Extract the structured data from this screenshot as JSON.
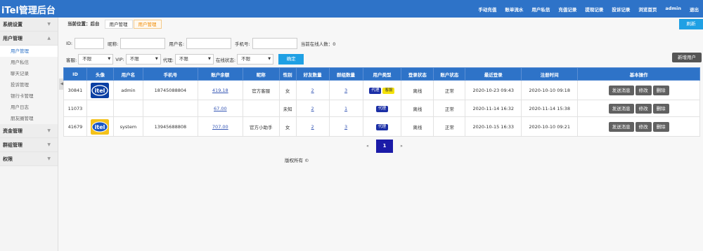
{
  "topbar": {
    "brand": "iTel管理后台",
    "nav": [
      "手动充值",
      "账单流水",
      "用户私信",
      "充值记录",
      "提现记录",
      "投诉记录",
      "浏览首页",
      "admin",
      "退出"
    ]
  },
  "sidebar": {
    "sections": [
      {
        "label": "系统设置",
        "items": []
      },
      {
        "label": "用户管理",
        "items": [
          "用户管理",
          "用户私信",
          "聊天记录",
          "投诉管理",
          "银行卡管理",
          "用户日志",
          "朋友圈管理"
        ]
      },
      {
        "label": "资金管理",
        "items": []
      },
      {
        "label": "群组管理",
        "items": []
      },
      {
        "label": "权限",
        "items": []
      }
    ]
  },
  "breadcrumb": {
    "prefix": "当前位置：后台",
    "level1": "用户管理",
    "current": "用户管理"
  },
  "refresh_label": "刷新",
  "filters": {
    "id_label": "ID:",
    "nickname_label": "昵称:",
    "username_label": "用户名:",
    "phone_label": "手机号:",
    "online_text": "当前在线人数：0",
    "cs_label": "客服:",
    "cs_value": "不限",
    "vip_label": "VIP:",
    "vip_value": "不限",
    "agent_label": "代理:",
    "agent_value": "不限",
    "online_label": "在线状态:",
    "online_value": "不限",
    "confirm": "确定",
    "new_user": "新增用户"
  },
  "table": {
    "headers": [
      "ID",
      "头像",
      "用户名",
      "手机号",
      "账户余额",
      "昵称",
      "性别",
      "好友数量",
      "群组数量",
      "用户类型",
      "登录状态",
      "账户状态",
      "最近登录",
      "注册时间",
      "基本操作"
    ],
    "rows": [
      {
        "id": "30841",
        "username": "admin",
        "phone": "18745088804",
        "balance": "419.18",
        "nickname": "官方客服",
        "gender": "女",
        "friends": "2",
        "groups": "3",
        "tags": [
          "代理",
          "客服"
        ],
        "login": "离线",
        "status": "正常",
        "last_login": "2020-10-23 09:43",
        "registered": "2020-10-10 09:18"
      },
      {
        "id": "11073",
        "username": "",
        "phone": "",
        "balance": "67.00",
        "nickname": "",
        "gender": "未知",
        "friends": "2",
        "groups": "1",
        "tags": [
          "代理"
        ],
        "login": "离线",
        "status": "正常",
        "last_login": "2020-11-14 16:32",
        "registered": "2020-11-14 15:38"
      },
      {
        "id": "41679",
        "username": "system",
        "phone": "13945688808",
        "balance": "707.00",
        "nickname": "官方小助手",
        "gender": "女",
        "friends": "2",
        "groups": "3",
        "tags": [
          "代理"
        ],
        "login": "离线",
        "status": "正常",
        "last_login": "2020-10-15 16:33",
        "registered": "2020-10-10 09:21"
      }
    ],
    "actions": [
      "发送消息",
      "修改",
      "删除"
    ]
  },
  "pager": {
    "prev": "«",
    "current": "1",
    "next": "»"
  },
  "copyright": "版权所有 ©",
  "colors": {
    "primary": "#2e73c8",
    "accent": "#1fa0e4",
    "tag_agent": "#1b2fa6",
    "tag_cs": "#f4e20a",
    "page_current": "#1b1ba8"
  }
}
